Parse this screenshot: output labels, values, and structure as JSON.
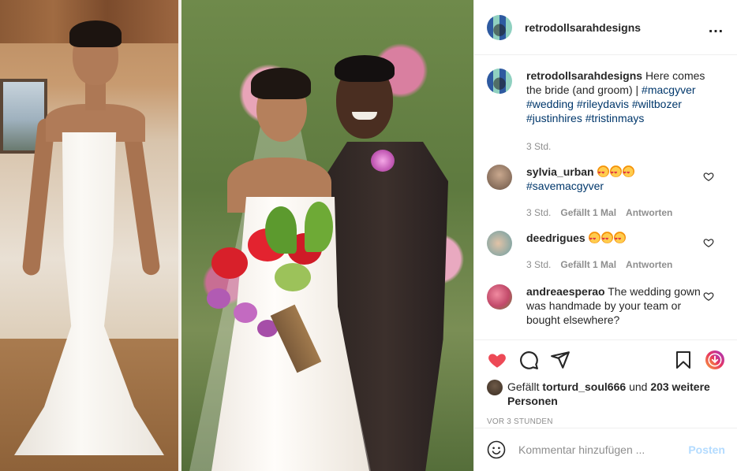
{
  "post": {
    "username": "retrodollsarahdesigns",
    "more_icon": "…"
  },
  "caption": {
    "username": "retrodollsarahdesigns",
    "text": "Here comes the bride (and groom) |",
    "tags": [
      "#macgyver",
      "#wedding",
      "#rileydavis",
      "#wiltbozer",
      "#justinhires",
      "#tristinmays"
    ],
    "time": "3 Std."
  },
  "comments": [
    {
      "user": "sylvia_urban",
      "emoji_count": 3,
      "text": "",
      "tags": [
        "#savemacgyver"
      ],
      "time": "3 Std.",
      "likes": "Gefällt 1 Mal",
      "reply": "Antworten",
      "avatar_color": "#7b6a5d"
    },
    {
      "user": "deedrigues",
      "emoji_count": 3,
      "text": "",
      "tags": [],
      "time": "3 Std.",
      "likes": "Gefällt 1 Mal",
      "reply": "Antworten",
      "avatar_color": "#8ea9a4"
    },
    {
      "user": "andreaesperao",
      "emoji_count": 0,
      "text": "The wedding gown was handmade by your team or bought elsewhere?",
      "tags": [],
      "time": "",
      "likes": "",
      "reply": "",
      "avatar_color": "#c24a6a"
    }
  ],
  "actions": {
    "like_icon": "heart-filled-icon",
    "comment_icon": "comment-icon",
    "share_icon": "share-icon",
    "save_icon": "bookmark-icon",
    "extra_icon": "download-icon",
    "like_color": "#ed4956"
  },
  "likes": {
    "prefix": "Gefällt",
    "user": "torturd_soul666",
    "and": "und",
    "others": "203 weitere Personen"
  },
  "timestamp": "VOR 3 STUNDEN",
  "add_comment": {
    "placeholder": "Kommentar hinzufügen ...",
    "post_label": "Posten"
  }
}
